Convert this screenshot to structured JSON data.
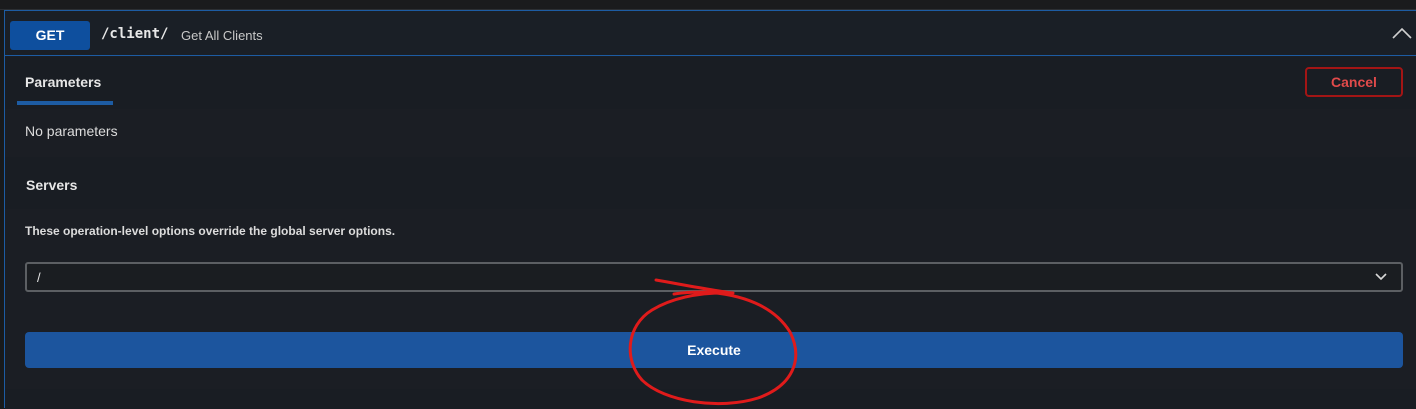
{
  "operation": {
    "method": "GET",
    "path": "/client/",
    "summary": "Get All Clients",
    "collapse_icon": "chevron-up-icon"
  },
  "tabs": {
    "parameters_label": "Parameters",
    "cancel_label": "Cancel"
  },
  "parameters": {
    "empty_text": "No parameters"
  },
  "servers": {
    "title": "Servers",
    "note": "These operation-level options override the global server options.",
    "selected": "/",
    "dropdown_icon": "chevron-down-icon"
  },
  "actions": {
    "execute_label": "Execute"
  },
  "colors": {
    "method_accent": "#0e4f9e",
    "cancel_red": "#a31515",
    "execute_blue": "#1c559e",
    "annotation_red": "#e01b1b"
  },
  "annotation": {
    "type": "hand-drawn-circle",
    "target": "execute-button"
  }
}
